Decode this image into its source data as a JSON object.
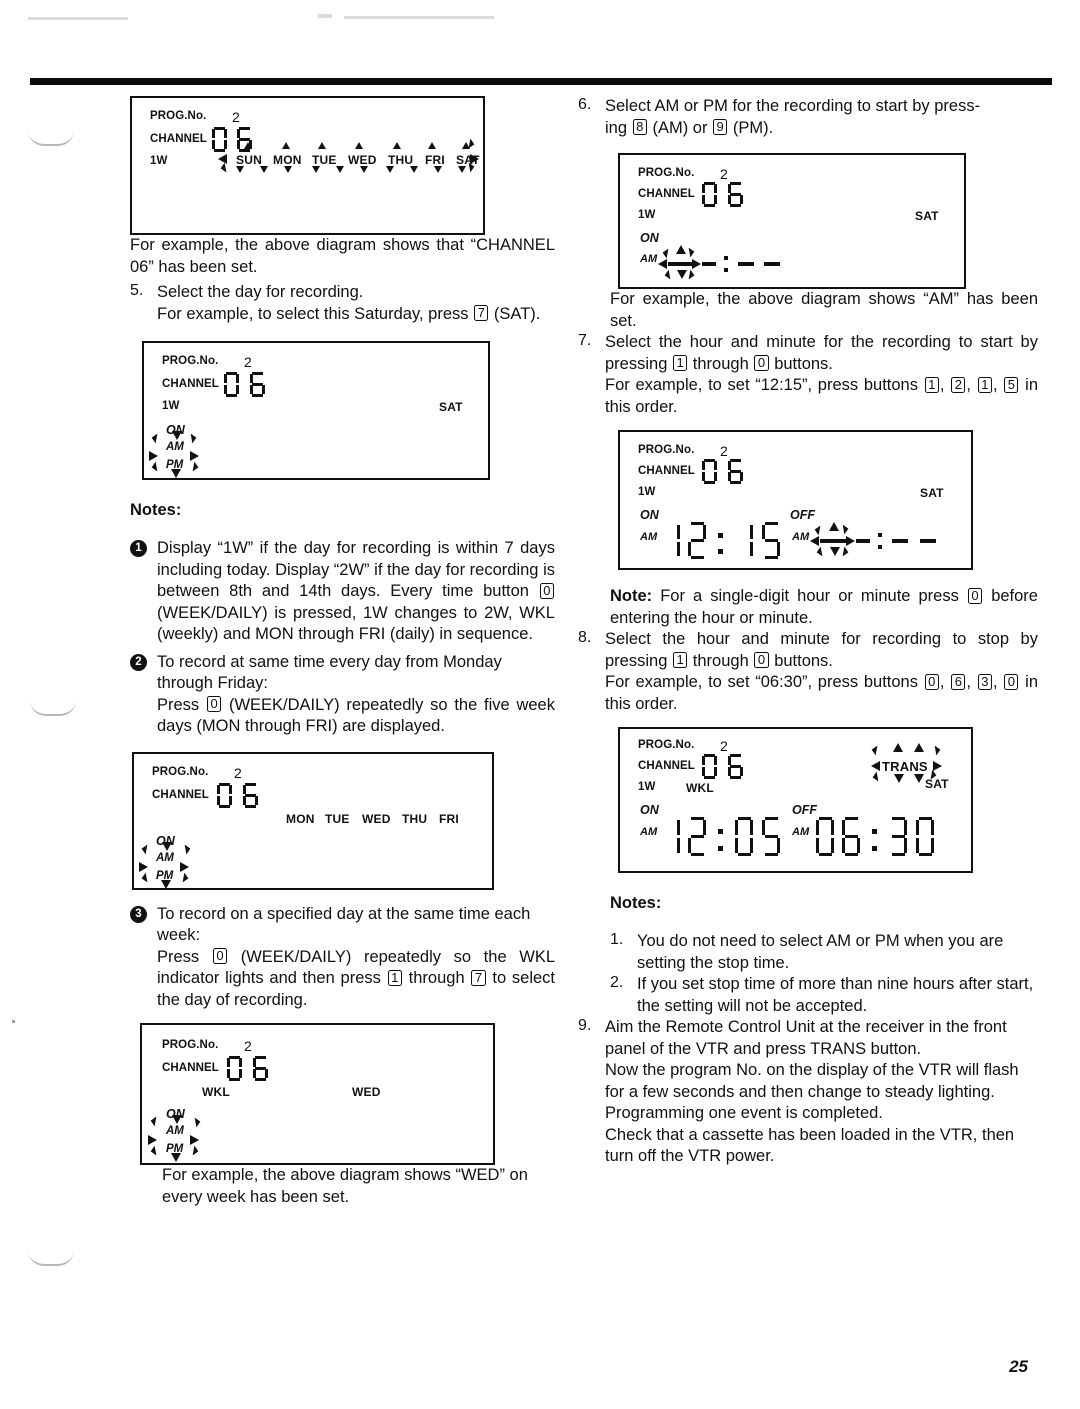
{
  "page": {
    "number": "25"
  },
  "left_column": {
    "diagram1": {
      "name": "lcd-display-channel-days",
      "prog_label": "PROG.No.",
      "prog_value": "2",
      "channel_label": "CHANNEL",
      "channel_digits": "06",
      "week_label": "1W",
      "days": [
        "SUN",
        "MON",
        "TUE",
        "WED",
        "THU",
        "FRI",
        "SAT"
      ]
    },
    "para1": "For example, the above diagram shows that “CHANNEL 06” has been set.",
    "step5": {
      "number": "5.",
      "line1": "Select the day for recording.",
      "line2_pre": "For example, to select this Saturday, press",
      "key": "7",
      "line2_post": "(SAT)."
    },
    "diagram2": {
      "name": "lcd-display-sat-ampm-flash",
      "prog_label": "PROG.No.",
      "prog_value": "2",
      "channel_label": "CHANNEL",
      "channel_digits": "06",
      "week_label": "1W",
      "day": "SAT",
      "on_label": "ON",
      "am_label": "AM",
      "pm_label": "PM"
    },
    "notes_heading": "Notes:",
    "note1": {
      "bullet": "1",
      "text_a": "Display “1W” if the day for recording is within 7 days including today.  Display “2W” if the day for recording is between 8th and 14th days. Every time button",
      "key": "0",
      "text_b": "(WEEK/DAILY) is pressed, 1W changes to 2W, WKL (weekly) and MON through FRI (daily) in sequence."
    },
    "note2": {
      "bullet": "2",
      "line1": "To record at same time every day from Monday through Friday:",
      "line2_pre": "Press",
      "key": "0",
      "line2_post": "(WEEK/DAILY) repeatedly so the five week days (MON through FRI) are displayed."
    },
    "diagram3": {
      "name": "lcd-display-weekdays",
      "prog_label": "PROG.No.",
      "prog_value": "2",
      "channel_label": "CHANNEL",
      "channel_digits": "06",
      "days": [
        "MON",
        "TUE",
        "WED",
        "THU",
        "FRI"
      ],
      "on_label": "ON",
      "am_label": "AM",
      "pm_label": "PM"
    },
    "note3": {
      "bullet": "3",
      "line1": "To record on a specified day at the same time each week:",
      "line2_pre": "Press",
      "key_a": "0",
      "line2_mid": "(WEEK/DAILY) repeatedly so the WKL indicator lights and then press",
      "key_b": "1",
      "line2_mid2": "through",
      "key_c": "7",
      "line2_post": "to select the day of recording."
    },
    "diagram4": {
      "name": "lcd-display-wkl-wed",
      "prog_label": "PROG.No.",
      "prog_value": "2",
      "channel_label": "CHANNEL",
      "channel_digits": "06",
      "wkl_label": "WKL",
      "day": "WED",
      "on_label": "ON",
      "am_label": "AM",
      "pm_label": "PM"
    },
    "para_last": "For example, the above diagram shows “WED” on every week has been set."
  },
  "right_column": {
    "step6": {
      "number": "6.",
      "line1": "Select AM or PM for the recording to start by press-",
      "line2_pre": "ing",
      "key_am": "8",
      "am_text": "(AM) or",
      "key_pm": "9",
      "pm_text": "(PM)."
    },
    "diagram5": {
      "name": "lcd-display-am-time-blank",
      "prog_label": "PROG.No.",
      "prog_value": "2",
      "channel_label": "CHANNEL",
      "channel_digits": "06",
      "week_label": "1W",
      "day": "SAT",
      "on_label": "ON",
      "am_label": "AM",
      "time": "--:--"
    },
    "para_am": "For example, the above diagram shows “AM” has been set.",
    "step7": {
      "number": "7.",
      "line1_pre": "Select the hour and minute for the recording to start by pressing",
      "key_a": "1",
      "line1_mid": "through",
      "key_b": "0",
      "line1_post": "buttons.",
      "line2_pre": "For example, to set “12:15”, press buttons",
      "key_1": "1",
      "key_2": "2",
      "key_3": "1",
      "key_4": "5",
      "line2_post": "in this order."
    },
    "diagram6": {
      "name": "lcd-display-on-1215-off-blank",
      "prog_label": "PROG.No.",
      "prog_value": "2",
      "channel_label": "CHANNEL",
      "channel_digits": "06",
      "week_label": "1W",
      "day": "SAT",
      "on_label": "ON",
      "off_label": "OFF",
      "am_label": "AM",
      "am_label2": "AM",
      "on_time": "12:15",
      "off_time": "--:--"
    },
    "note_single": {
      "heading": "Note:",
      "text_pre": "For a single-digit hour or minute press",
      "key": "0",
      "text_post": "before entering the hour or minute."
    },
    "step8": {
      "number": "8.",
      "line1_pre": "Select the hour and minute for recording to stop by pressing",
      "key_a": "1",
      "line1_mid": "through",
      "key_b": "0",
      "line1_post": "buttons.",
      "line2_pre": "For example, to set “06:30”, press buttons",
      "key_1": "0",
      "key_2": "6",
      "key_3": "3",
      "key_4": "0",
      "line2_post": "in this order."
    },
    "diagram7": {
      "name": "lcd-display-trans-full",
      "prog_label": "PROG.No.",
      "prog_value": "2",
      "channel_label": "CHANNEL",
      "channel_digits": "06",
      "week_label": "1W",
      "wkl_label": "WKL",
      "trans_label": "TRANS",
      "day": "SAT",
      "on_label": "ON",
      "off_label": "OFF",
      "am_label": "AM",
      "am_label2": "AM",
      "on_time": "12:05",
      "off_time": "06:30"
    },
    "notes_heading": "Notes:",
    "note_1": {
      "number": "1.",
      "text": "You do not need to select AM or PM when you are setting the stop time."
    },
    "note_2": {
      "number": "2.",
      "text": "If you set stop time of more than nine hours after start, the setting will not be accepted."
    },
    "step9": {
      "number": "9.",
      "text": "Aim the Remote Control Unit at the receiver in the front panel of the VTR and press TRANS button."
    },
    "closing1": "Now the program No. on the display of the VTR will flash for a few seconds and then change to steady lighting.",
    "closing2": "Programming one event is completed.",
    "closing3": "Check that a cassette has been loaded in the VTR, then turn off the VTR power."
  }
}
